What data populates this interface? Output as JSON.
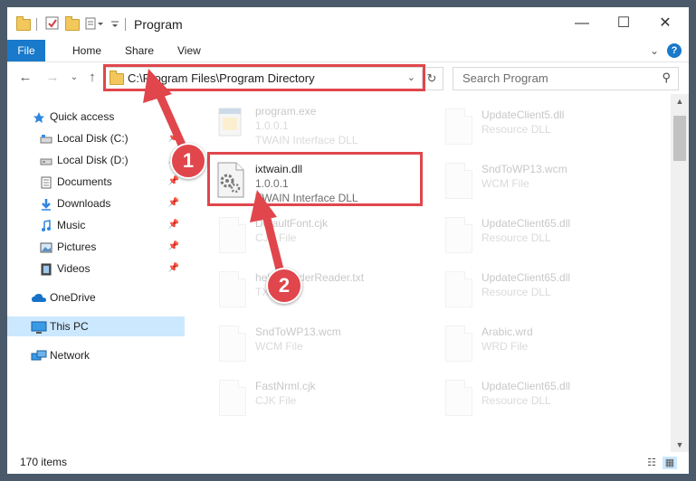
{
  "window": {
    "title": "Program"
  },
  "ribbon": {
    "tabs": [
      "File",
      "Home",
      "Share",
      "View"
    ]
  },
  "address": {
    "path": "C:\\Program Files\\Program Directory",
    "search_placeholder": "Search Program"
  },
  "nav": {
    "items": [
      {
        "label": "Quick access",
        "icon": "star-icon"
      },
      {
        "label": "Local Disk (C:)",
        "icon": "drive-icon"
      },
      {
        "label": "Local Disk (D:)",
        "icon": "drive-icon"
      },
      {
        "label": "Documents",
        "icon": "documents-icon"
      },
      {
        "label": "Downloads",
        "icon": "download-icon"
      },
      {
        "label": "Music",
        "icon": "music-icon"
      },
      {
        "label": "Pictures",
        "icon": "pictures-icon"
      },
      {
        "label": "Videos",
        "icon": "videos-icon"
      },
      {
        "label": "OneDrive",
        "icon": "cloud-icon"
      },
      {
        "label": "This PC",
        "icon": "computer-icon"
      },
      {
        "label": "Network",
        "icon": "network-icon"
      }
    ]
  },
  "files": {
    "left": [
      {
        "name": "program.exe",
        "sub1": "1.0.0.1",
        "sub2": "TWAIN Interface DLL"
      },
      {
        "name": "ixtwain.dll",
        "sub1": "1.0.0.1",
        "sub2": "TWAIN Interface DLL"
      },
      {
        "name": "DefaultFont.cjk",
        "sub1": "CJK File",
        "sub2": ""
      },
      {
        "name": "help ReaderReader.txt",
        "sub1": "TXT File",
        "sub2": ""
      },
      {
        "name": "SndToWP13.wcm",
        "sub1": "WCM File",
        "sub2": ""
      },
      {
        "name": "FastNrml.cjk",
        "sub1": "CJK File",
        "sub2": ""
      }
    ],
    "right": [
      {
        "name": "UpdateClient5.dll",
        "sub1": "Resource DLL"
      },
      {
        "name": "SndToWP13.wcm",
        "sub1": "WCM File"
      },
      {
        "name": "UpdateClient65.dll",
        "sub1": "Resource DLL"
      },
      {
        "name": "UpdateClient65.dll",
        "sub1": "Resource DLL"
      },
      {
        "name": "Arabic.wrd",
        "sub1": "WRD File"
      },
      {
        "name": "UpdateClient65.dll",
        "sub1": "Resource DLL"
      }
    ]
  },
  "status": {
    "count": "170 items"
  },
  "annotations": {
    "step1": "1",
    "step2": "2"
  },
  "colors": {
    "accent": "#1979ca",
    "highlight": "#e0464c",
    "selected": "#cce8ff"
  }
}
